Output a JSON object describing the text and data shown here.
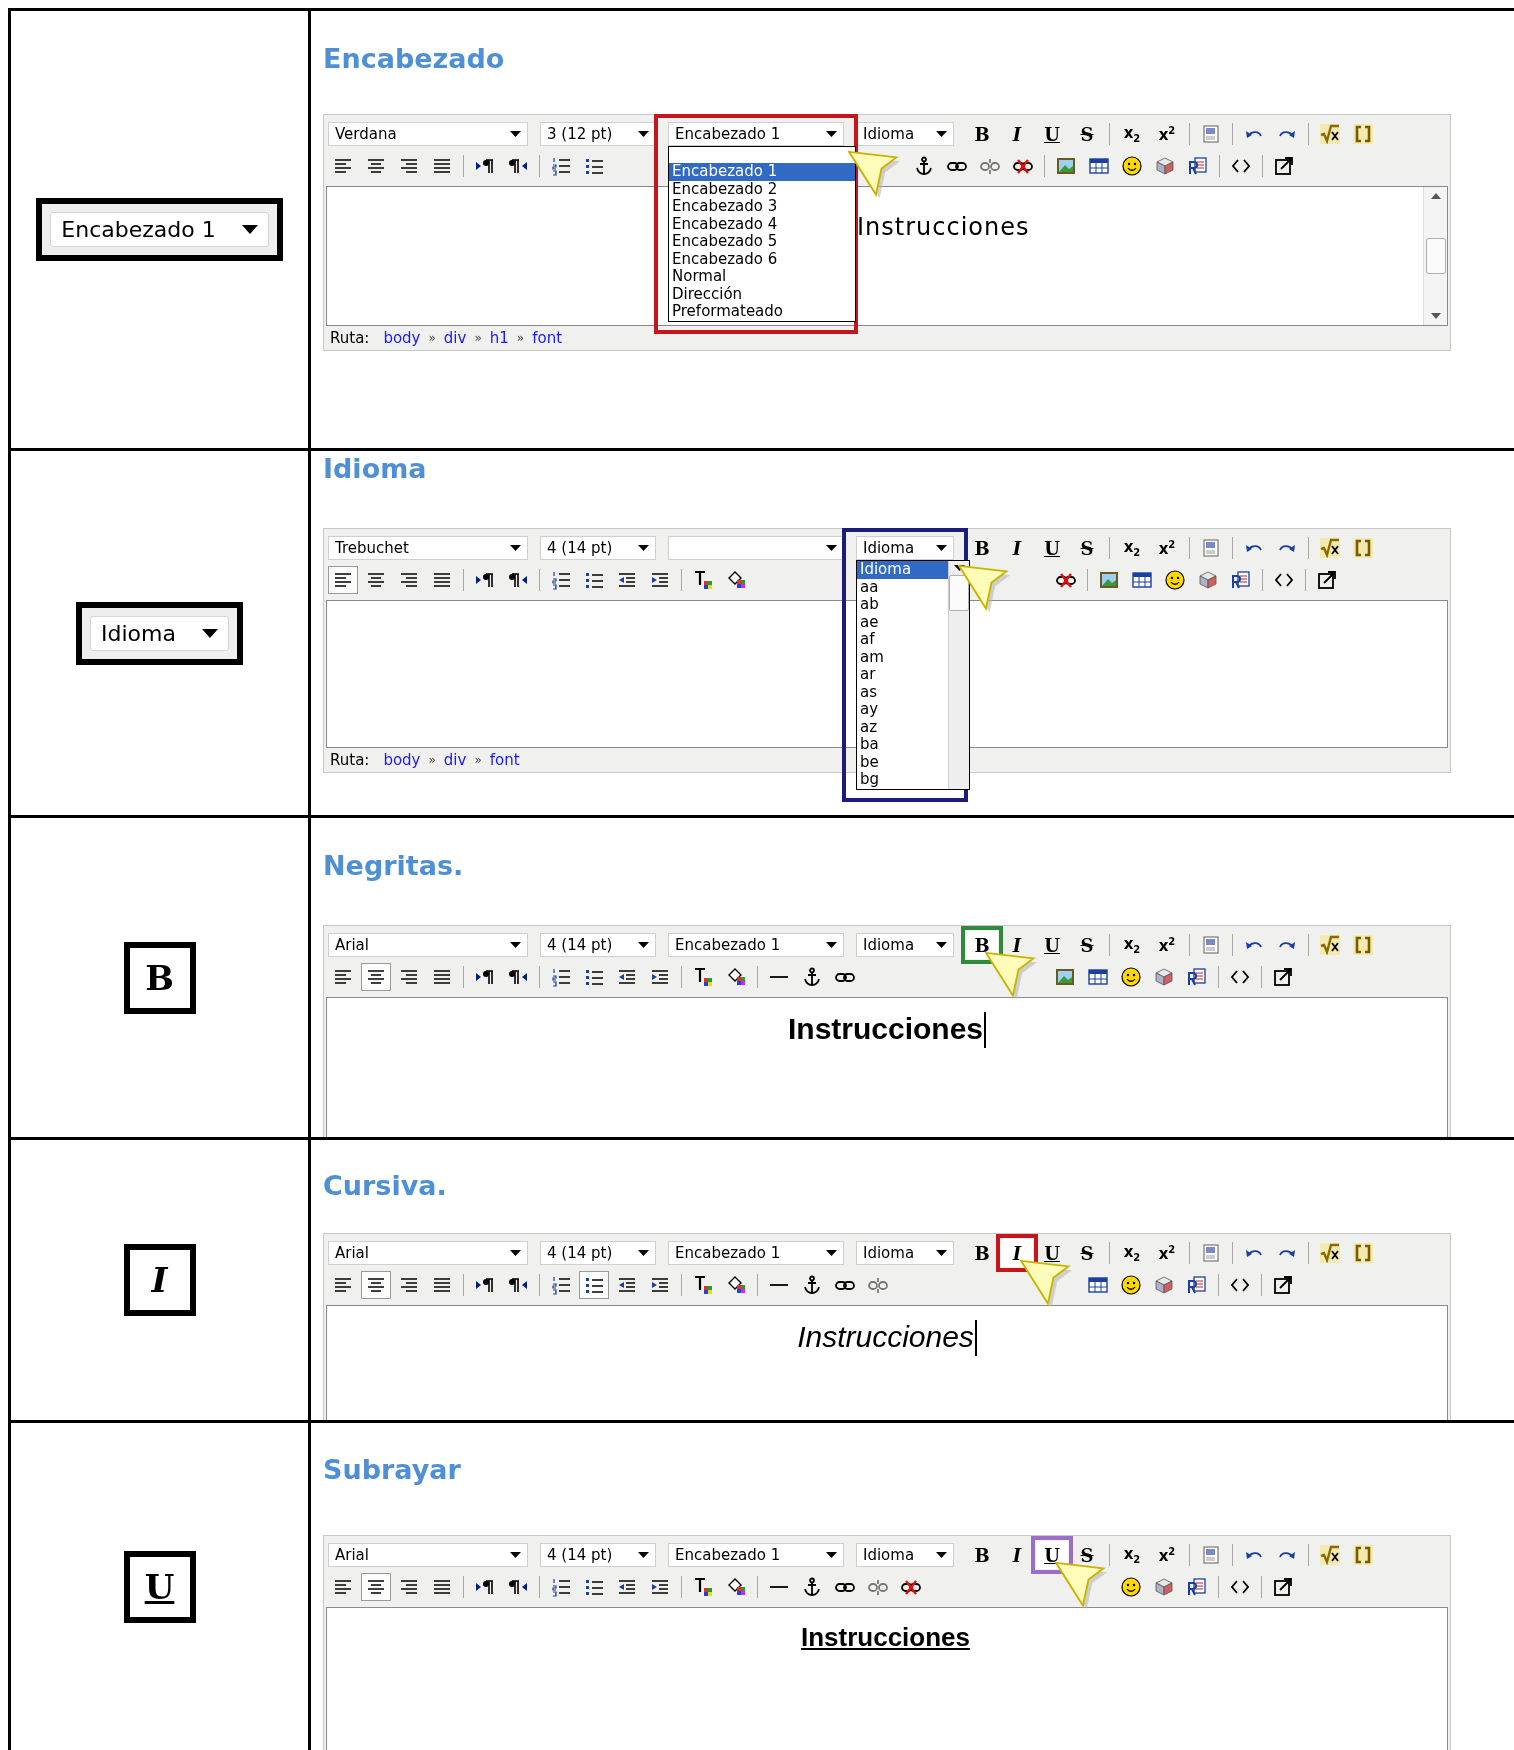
{
  "rows": [
    {
      "sample": {
        "kind": "select",
        "label": "Encabezado 1"
      },
      "title": "Encabezado",
      "color": "#c4161c",
      "editor": {
        "selects": [
          {
            "value": "Verdana",
            "highlighted": false
          },
          {
            "value": "3 (12 pt)",
            "highlighted": false
          },
          {
            "value": "Encabezado 1",
            "highlighted": true
          },
          {
            "value": "Idioma",
            "highlighted": false
          }
        ],
        "dropdown": {
          "scrollbar": false,
          "options": [
            {
              "label": "Encabezado 1",
              "selected": true
            },
            {
              "label": "Encabezado 2",
              "selected": false
            },
            {
              "label": "Encabezado 3",
              "selected": false
            },
            {
              "label": "Encabezado 4",
              "selected": false
            },
            {
              "label": "Encabezado 5",
              "selected": false
            },
            {
              "label": "Encabezado 6",
              "selected": false
            },
            {
              "label": "Normal",
              "selected": false
            },
            {
              "label": "Dirección",
              "selected": false
            },
            {
              "label": "Preformateado",
              "selected": false
            }
          ]
        },
        "row_1": [
          [
            {
              "kind": "bold",
              "label": "B",
              "highlighted": false
            },
            {
              "kind": "italic",
              "label": "I",
              "highlighted": false
            },
            {
              "kind": "underline",
              "label": "U",
              "highlighted": false
            },
            {
              "kind": "strike",
              "label": "S",
              "highlighted": false
            }
          ],
          [
            {
              "kind": "subscript",
              "label": "x$_{2}$",
              "highlighted": false
            },
            {
              "kind": "superscript",
              "label": "x$^{2}$",
              "highlighted": false
            }
          ],
          [
            {
              "kind": "word",
              "highlighted": false
            }
          ],
          [
            {
              "kind": "undo",
              "highlighted": false
            },
            {
              "kind": "redo",
              "highlighted": false
            }
          ],
          [
            {
              "kind": "math",
              "highlighted": false
            },
            {
              "kind": "brackets",
              "highlighted": false
            }
          ]
        ],
        "row_2": [
          [
            {
              "kind": "align-left",
              "pressed": false
            },
            {
              "kind": "align-center",
              "pressed": false
            },
            {
              "kind": "align-right",
              "pressed": false
            },
            {
              "kind": "justify",
              "pressed": false
            }
          ],
          [
            {
              "kind": "ltr",
              "pressed": false
            },
            {
              "kind": "rtl",
              "pressed": false
            }
          ],
          [
            {
              "kind": "ol",
              "pressed": false
            },
            {
              "kind": "ul",
              "pressed": false
            }
          ]
        ],
        "row_2_right": [
          [
            {
              "kind": "anchor",
              "pressed": false
            },
            {
              "kind": "link",
              "pressed": false
            },
            {
              "kind": "unlink",
              "pressed": false
            },
            {
              "kind": "nolink",
              "pressed": false
            }
          ],
          [
            {
              "kind": "image",
              "pressed": false
            },
            {
              "kind": "table",
              "pressed": false
            },
            {
              "kind": "smiley",
              "pressed": false
            },
            {
              "kind": "cube",
              "pressed": false
            },
            {
              "kind": "paste",
              "pressed": false
            }
          ],
          [
            {
              "kind": "code",
              "pressed": false
            }
          ],
          [
            {
              "kind": "fullscreen",
              "pressed": false
            }
          ]
        ],
        "content": {
          "text": "Instrucciones",
          "caret": false,
          "scrollbar": true
        },
        "path": [
          {
            "kind": "label",
            "text": "Ruta:"
          },
          {
            "kind": "link",
            "text": "body"
          },
          {
            "kind": "sep",
            "text": "»"
          },
          {
            "kind": "link",
            "text": "div"
          },
          {
            "kind": "sep",
            "text": "»"
          },
          {
            "kind": "link",
            "text": "h1"
          },
          {
            "kind": "sep",
            "text": "»"
          },
          {
            "kind": "link",
            "text": "font"
          }
        ]
      }
    },
    {
      "sample": {
        "kind": "select",
        "label": "Idioma"
      },
      "title": "Idioma",
      "color": "#1c1c7c",
      "editor": {
        "selects": [
          {
            "value": "Trebuchet",
            "highlighted": false
          },
          {
            "value": "4 (14 pt)",
            "highlighted": false
          },
          {
            "highlighted": false
          },
          {
            "value": "Idioma",
            "highlighted": true
          }
        ],
        "dropdown": {
          "scrollbar": true,
          "options": [
            {
              "label": "Idioma",
              "selected": true
            },
            {
              "label": "aa",
              "selected": false
            },
            {
              "label": "ab",
              "selected": false
            },
            {
              "label": "ae",
              "selected": false
            },
            {
              "label": "af",
              "selected": false
            },
            {
              "label": "am",
              "selected": false
            },
            {
              "label": "ar",
              "selected": false
            },
            {
              "label": "as",
              "selected": false
            },
            {
              "label": "ay",
              "selected": false
            },
            {
              "label": "az",
              "selected": false
            },
            {
              "label": "ba",
              "selected": false
            },
            {
              "label": "be",
              "selected": false
            },
            {
              "label": "bg",
              "selected": false
            }
          ]
        },
        "row_1": [
          [
            {
              "kind": "bold",
              "label": "B",
              "highlighted": false
            },
            {
              "kind": "italic",
              "label": "I",
              "highlighted": false
            },
            {
              "kind": "underline",
              "label": "U",
              "highlighted": false
            },
            {
              "kind": "strike",
              "label": "S",
              "highlighted": false
            }
          ],
          [
            {
              "kind": "subscript",
              "label": "x$_{2}$",
              "highlighted": false
            },
            {
              "kind": "superscript",
              "label": "x$^{2}$",
              "highlighted": false
            }
          ],
          [
            {
              "kind": "word",
              "highlighted": false
            }
          ],
          [
            {
              "kind": "undo",
              "highlighted": false
            },
            {
              "kind": "redo",
              "highlighted": false
            }
          ],
          [
            {
              "kind": "math",
              "highlighted": false
            },
            {
              "kind": "brackets",
              "highlighted": false
            }
          ]
        ],
        "row_2": [
          [
            {
              "kind": "align-left",
              "pressed": true
            },
            {
              "kind": "align-center",
              "pressed": false
            },
            {
              "kind": "align-right",
              "pressed": false
            },
            {
              "kind": "justify",
              "pressed": false
            }
          ],
          [
            {
              "kind": "ltr",
              "pressed": false
            },
            {
              "kind": "rtl",
              "pressed": false
            }
          ],
          [
            {
              "kind": "ol",
              "pressed": false
            },
            {
              "kind": "ul",
              "pressed": false
            },
            {
              "kind": "outdent",
              "pressed": false
            },
            {
              "kind": "indent",
              "pressed": false
            }
          ],
          [
            {
              "kind": "text-color",
              "pressed": false
            },
            {
              "kind": "bg-color",
              "pressed": false
            }
          ]
        ],
        "row_2_right": [
          [
            {
              "kind": "nolink",
              "pressed": false
            }
          ],
          [
            {
              "kind": "image",
              "pressed": false
            },
            {
              "kind": "table",
              "pressed": false
            },
            {
              "kind": "smiley",
              "pressed": false
            },
            {
              "kind": "cube",
              "pressed": false
            },
            {
              "kind": "paste",
              "pressed": false
            }
          ],
          [
            {
              "kind": "code",
              "pressed": false
            }
          ],
          [
            {
              "kind": "fullscreen",
              "pressed": false
            }
          ]
        ],
        "content": {
          "scrollbar": false
        },
        "path": [
          {
            "kind": "label",
            "text": "Ruta:"
          },
          {
            "kind": "link",
            "text": "body"
          },
          {
            "kind": "sep",
            "text": "»"
          },
          {
            "kind": "link",
            "text": "div"
          },
          {
            "kind": "sep",
            "text": "»"
          },
          {
            "kind": "link",
            "text": "font"
          }
        ]
      }
    },
    {
      "sample": {
        "kind": "bold",
        "label": "B"
      },
      "title": "Negritas.",
      "color": "#2e8b3a",
      "editor": {
        "selects": [
          {
            "value": "Arial",
            "highlighted": false
          },
          {
            "value": "4 (14 pt)",
            "highlighted": false
          },
          {
            "value": "Encabezado 1",
            "highlighted": false
          },
          {
            "value": "Idioma",
            "highlighted": false
          }
        ],
        "row_1": [
          [
            {
              "kind": "bold",
              "label": "B",
              "highlighted": true
            },
            {
              "kind": "italic",
              "label": "I",
              "highlighted": false
            },
            {
              "kind": "underline",
              "label": "U",
              "highlighted": false
            },
            {
              "kind": "strike",
              "label": "S",
              "highlighted": false
            }
          ],
          [
            {
              "kind": "subscript",
              "label": "x$_{2}$",
              "highlighted": false
            },
            {
              "kind": "superscript",
              "label": "x$^{2}$",
              "highlighted": false
            }
          ],
          [
            {
              "kind": "word",
              "highlighted": false
            }
          ],
          [
            {
              "kind": "undo",
              "highlighted": false
            },
            {
              "kind": "redo",
              "highlighted": false
            }
          ],
          [
            {
              "kind": "math",
              "highlighted": false
            },
            {
              "kind": "brackets",
              "highlighted": false
            }
          ]
        ],
        "row_2": [
          [
            {
              "kind": "align-left",
              "pressed": false
            },
            {
              "kind": "align-center",
              "pressed": true
            },
            {
              "kind": "align-right",
              "pressed": false
            },
            {
              "kind": "justify",
              "pressed": false
            }
          ],
          [
            {
              "kind": "ltr",
              "pressed": false
            },
            {
              "kind": "rtl",
              "pressed": false
            }
          ],
          [
            {
              "kind": "ol",
              "pressed": false
            },
            {
              "kind": "ul",
              "pressed": false
            },
            {
              "kind": "outdent",
              "pressed": false
            },
            {
              "kind": "indent",
              "pressed": false
            }
          ],
          [
            {
              "kind": "text-color",
              "pressed": false
            },
            {
              "kind": "bg-color",
              "pressed": false
            }
          ],
          [
            {
              "kind": "hr",
              "pressed": false
            },
            {
              "kind": "anchor",
              "pressed": false
            },
            {
              "kind": "link",
              "pressed": false
            }
          ]
        ],
        "row_2_right": [
          [
            {
              "kind": "image",
              "pressed": false
            },
            {
              "kind": "table",
              "pressed": false
            },
            {
              "kind": "smiley",
              "pressed": false
            },
            {
              "kind": "cube",
              "pressed": false
            },
            {
              "kind": "paste",
              "pressed": false
            }
          ],
          [
            {
              "kind": "code",
              "pressed": false
            }
          ],
          [
            {
              "kind": "fullscreen",
              "pressed": false
            }
          ]
        ],
        "content": {
          "text": "Instrucciones",
          "caret": true,
          "scrollbar": false
        }
      }
    },
    {
      "sample": {
        "kind": "italic",
        "label": "I"
      },
      "title": "Cursiva.",
      "color": "#c4161c",
      "editor": {
        "selects": [
          {
            "value": "Arial",
            "highlighted": false
          },
          {
            "value": "4 (14 pt)",
            "highlighted": false
          },
          {
            "value": "Encabezado 1",
            "highlighted": false
          },
          {
            "value": "Idioma",
            "highlighted": false
          }
        ],
        "row_1": [
          [
            {
              "kind": "bold",
              "label": "B",
              "highlighted": false
            },
            {
              "kind": "italic",
              "label": "I",
              "highlighted": true
            },
            {
              "kind": "underline",
              "label": "U",
              "highlighted": false
            },
            {
              "kind": "strike",
              "label": "S",
              "highlighted": false
            }
          ],
          [
            {
              "kind": "subscript",
              "label": "x$_{2}$",
              "highlighted": false
            },
            {
              "kind": "superscript",
              "label": "x$^{2}$",
              "highlighted": false
            }
          ],
          [
            {
              "kind": "word",
              "highlighted": false
            }
          ],
          [
            {
              "kind": "undo",
              "highlighted": false
            },
            {
              "kind": "redo",
              "highlighted": false
            }
          ],
          [
            {
              "kind": "math",
              "highlighted": false
            },
            {
              "kind": "brackets",
              "highlighted": false
            }
          ]
        ],
        "row_2": [
          [
            {
              "kind": "align-left",
              "pressed": false
            },
            {
              "kind": "align-center",
              "pressed": true
            },
            {
              "kind": "align-right",
              "pressed": false
            },
            {
              "kind": "justify",
              "pressed": false
            }
          ],
          [
            {
              "kind": "ltr",
              "pressed": false
            },
            {
              "kind": "rtl",
              "pressed": false
            }
          ],
          [
            {
              "kind": "ol",
              "pressed": false
            },
            {
              "kind": "ul",
              "pressed": true
            },
            {
              "kind": "outdent",
              "pressed": false
            },
            {
              "kind": "indent",
              "pressed": false
            }
          ],
          [
            {
              "kind": "text-color",
              "pressed": false
            },
            {
              "kind": "bg-color",
              "pressed": false
            }
          ],
          [
            {
              "kind": "hr",
              "pressed": false
            },
            {
              "kind": "anchor",
              "pressed": false
            },
            {
              "kind": "link",
              "pressed": false
            },
            {
              "kind": "unlink",
              "pressed": false
            }
          ]
        ],
        "row_2_right": [
          [
            {
              "kind": "table",
              "pressed": false
            },
            {
              "kind": "smiley",
              "pressed": false
            },
            {
              "kind": "cube",
              "pressed": false
            },
            {
              "kind": "paste",
              "pressed": false
            }
          ],
          [
            {
              "kind": "code",
              "pressed": false
            }
          ],
          [
            {
              "kind": "fullscreen",
              "pressed": false
            }
          ]
        ],
        "content": {
          "text": "Instrucciones",
          "caret": true,
          "scrollbar": false
        }
      }
    },
    {
      "sample": {
        "kind": "underline",
        "label": "U"
      },
      "title": "Subrayar",
      "color": "#9b6fc9",
      "editor": {
        "selects": [
          {
            "value": "Arial",
            "highlighted": false
          },
          {
            "value": "4 (14 pt)",
            "highlighted": false
          },
          {
            "value": "Encabezado 1",
            "highlighted": false
          },
          {
            "value": "Idioma",
            "highlighted": false
          }
        ],
        "row_1": [
          [
            {
              "kind": "bold",
              "label": "B",
              "highlighted": false
            },
            {
              "kind": "italic",
              "label": "I",
              "highlighted": false
            },
            {
              "kind": "underline",
              "label": "U",
              "highlighted": true
            },
            {
              "kind": "strike",
              "label": "S",
              "highlighted": false
            }
          ],
          [
            {
              "kind": "subscript",
              "label": "x$_{2}$",
              "highlighted": false
            },
            {
              "kind": "superscript",
              "label": "x$^{2}$",
              "highlighted": false
            }
          ],
          [
            {
              "kind": "word",
              "highlighted": false
            }
          ],
          [
            {
              "kind": "undo",
              "highlighted": false
            },
            {
              "kind": "redo",
              "highlighted": false
            }
          ],
          [
            {
              "kind": "math",
              "highlighted": false
            },
            {
              "kind": "brackets",
              "highlighted": false
            }
          ]
        ],
        "row_2": [
          [
            {
              "kind": "align-left",
              "pressed": false
            },
            {
              "kind": "align-center",
              "pressed": true
            },
            {
              "kind": "align-right",
              "pressed": false
            },
            {
              "kind": "justify",
              "pressed": false
            }
          ],
          [
            {
              "kind": "ltr",
              "pressed": false
            },
            {
              "kind": "rtl",
              "pressed": false
            }
          ],
          [
            {
              "kind": "ol",
              "pressed": false
            },
            {
              "kind": "ul",
              "pressed": false
            },
            {
              "kind": "outdent",
              "pressed": false
            },
            {
              "kind": "indent",
              "pressed": false
            }
          ],
          [
            {
              "kind": "text-color",
              "pressed": false
            },
            {
              "kind": "bg-color",
              "pressed": false
            }
          ],
          [
            {
              "kind": "hr",
              "pressed": false
            },
            {
              "kind": "anchor",
              "pressed": false
            },
            {
              "kind": "link",
              "pressed": false
            },
            {
              "kind": "unlink",
              "pressed": false
            },
            {
              "kind": "nolink",
              "pressed": false
            }
          ]
        ],
        "row_2_right": [
          [
            {
              "kind": "smiley",
              "pressed": false
            },
            {
              "kind": "cube",
              "pressed": false
            },
            {
              "kind": "paste",
              "pressed": false
            }
          ],
          [
            {
              "kind": "code",
              "pressed": false
            }
          ],
          [
            {
              "kind": "fullscreen",
              "pressed": false
            }
          ]
        ],
        "content": {
          "text": "Instrucciones",
          "caret": false,
          "scrollbar": false
        }
      }
    }
  ]
}
